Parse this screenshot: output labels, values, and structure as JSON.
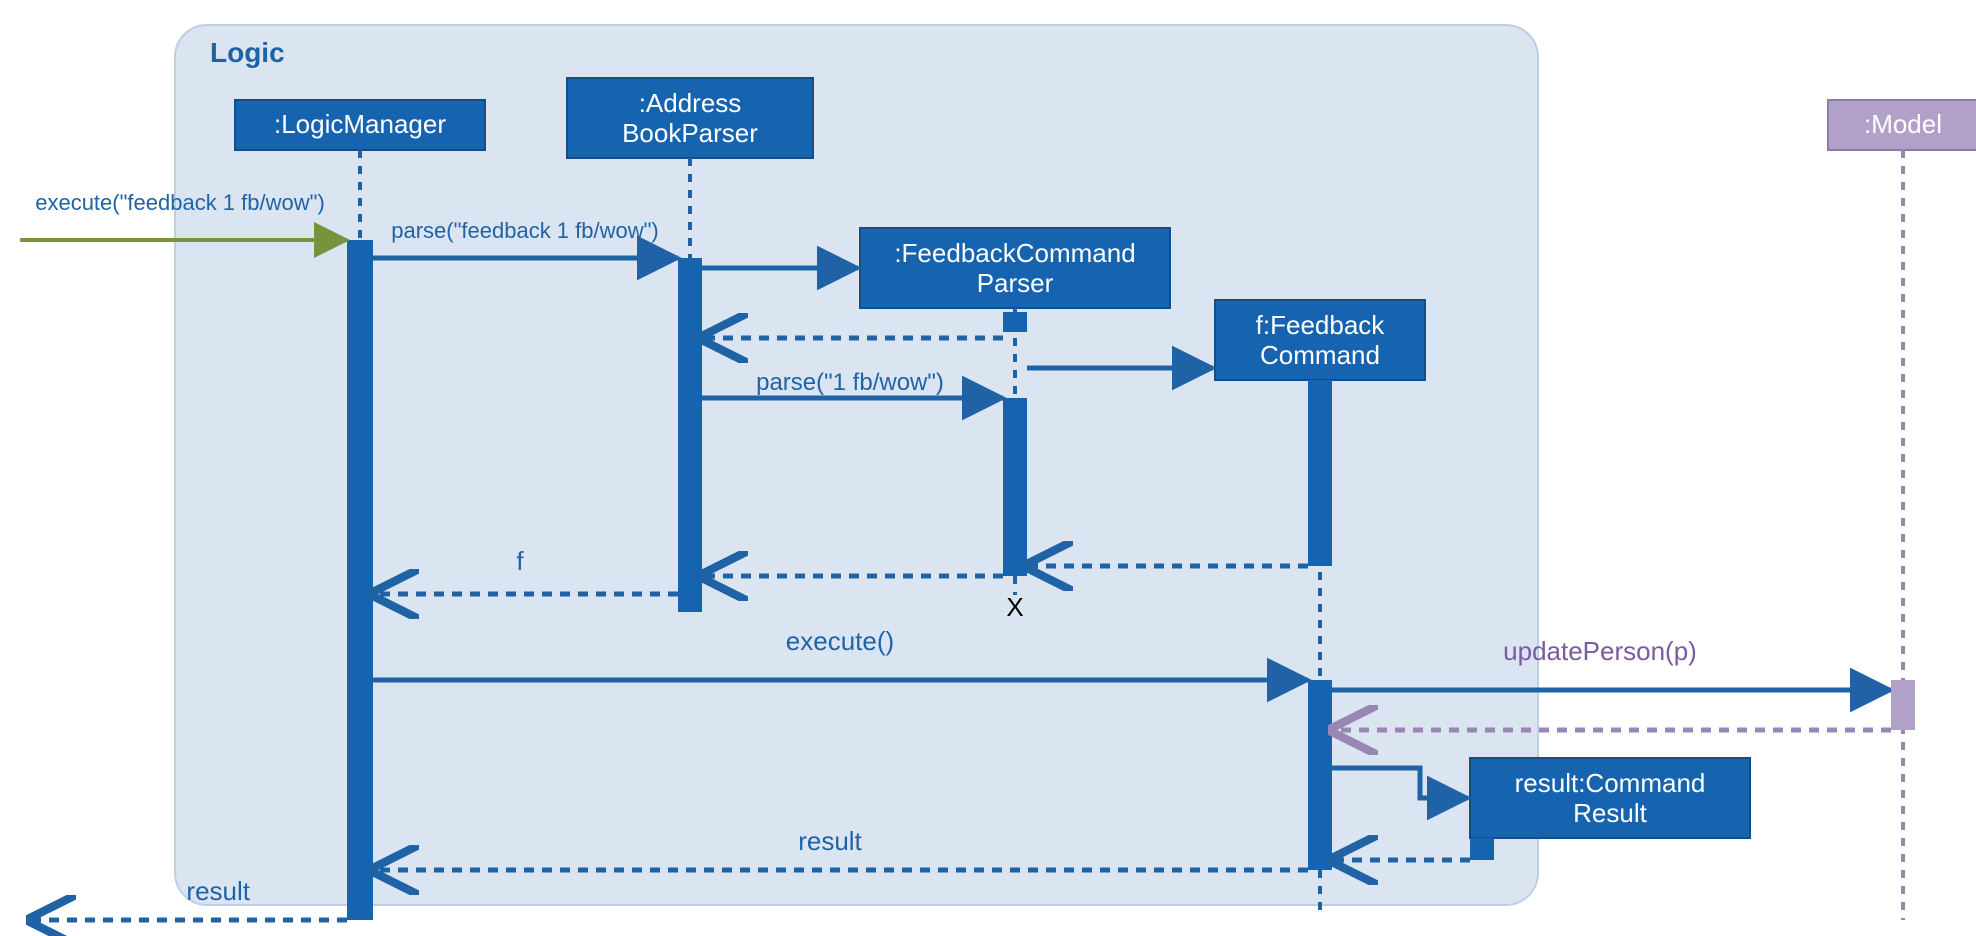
{
  "frame": {
    "label": "Logic"
  },
  "lifelines": {
    "logicManager": {
      "label": ":LogicManager"
    },
    "addressBookParser": {
      "line1": ":Address",
      "line2": "BookParser"
    },
    "feedbackCommandParser": {
      "line1": ":FeedbackCommand",
      "line2": "Parser"
    },
    "feedbackCommand": {
      "line1": "f:Feedback",
      "line2": "Command"
    },
    "commandResult": {
      "line1": "result:Command",
      "line2": "Result"
    },
    "model": {
      "label": ":Model"
    }
  },
  "messages": {
    "executeIn": "execute(\"feedback 1 fb/wow\")",
    "parse1": "parse(\"feedback 1 fb/wow\")",
    "parse2": "parse(\"1 fb/wow\")",
    "f": "f",
    "execute": "execute()",
    "updatePerson": "updatePerson(p)",
    "result": "result",
    "resultOut": "result",
    "destroy": "X"
  },
  "colors": {
    "frameBg": "#dbe5f1",
    "frameBorder": "#9fb9d8",
    "blueFill": "#1664b0",
    "blueLine": "#1f63a6",
    "purpleFill": "#b1a0c7",
    "purpleLine": "#9a86b5",
    "green": "#77933c"
  }
}
